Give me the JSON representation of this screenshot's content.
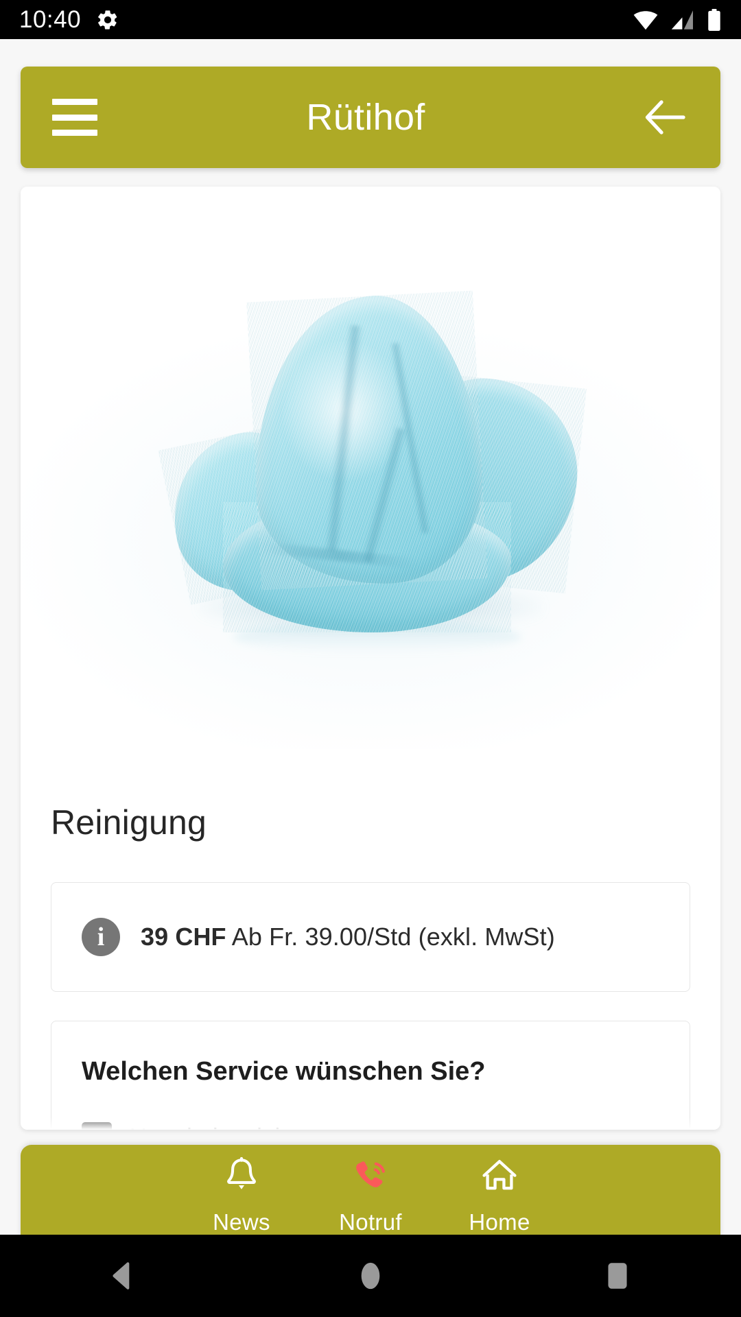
{
  "status_bar": {
    "time": "10:40",
    "icons": [
      "settings-gear-icon",
      "wifi-icon",
      "cellular-signal-icon",
      "battery-icon"
    ]
  },
  "app_bar": {
    "title": "Rütihof",
    "menu_icon": "hamburger-menu-icon",
    "back_icon": "arrow-left-icon",
    "background_color": "#AEAA26"
  },
  "main": {
    "hero_image_alt": "Blaues Mikrofasertuch",
    "section_title": "Reinigung",
    "price": {
      "icon": "info-icon",
      "amount": "39 CHF",
      "detail": "Ab Fr. 39.00/Std (exkl. MwSt)"
    },
    "service": {
      "question": "Welchen Service wünschen Sie?",
      "option_label": "Unterhaltsreinigung"
    }
  },
  "bottom_nav": {
    "items": [
      {
        "label": "News",
        "icon": "bell-icon",
        "color": "#FFFFFF"
      },
      {
        "label": "Notruf",
        "icon": "phone-icon",
        "color": "#FA5A5A"
      },
      {
        "label": "Home",
        "icon": "home-icon",
        "color": "#FFFFFF"
      }
    ]
  },
  "system_nav": {
    "back": "back-triangle-icon",
    "home": "home-circle-icon",
    "recents": "recents-square-icon"
  }
}
